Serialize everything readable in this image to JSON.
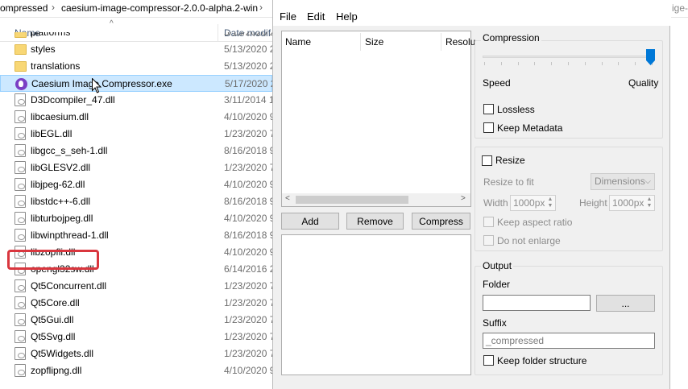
{
  "explorer": {
    "breadcrumb": [
      "ompressed",
      "caesium-image-compressor-2.0.0-alpha.2-win"
    ],
    "breadcrumb_tail": "ige-",
    "columns": {
      "name": "Name",
      "date": "Date modif"
    },
    "rows": [
      {
        "name": "platforms",
        "date": "5/13/2020 2",
        "type": "folder",
        "selected": false
      },
      {
        "name": "styles",
        "date": "5/13/2020 2",
        "type": "folder",
        "selected": false
      },
      {
        "name": "translations",
        "date": "5/13/2020 2",
        "type": "folder",
        "selected": false
      },
      {
        "name": "Caesium Image Compressor.exe",
        "date": "5/17/2020 2",
        "type": "exe",
        "selected": true
      },
      {
        "name": "D3Dcompiler_47.dll",
        "date": "3/11/2014 1",
        "type": "file",
        "selected": false
      },
      {
        "name": "libcaesium.dll",
        "date": "4/10/2020 9",
        "type": "file",
        "selected": false
      },
      {
        "name": "libEGL.dll",
        "date": "1/23/2020 7",
        "type": "file",
        "selected": false
      },
      {
        "name": "libgcc_s_seh-1.dll",
        "date": "8/16/2018 9",
        "type": "file",
        "selected": false
      },
      {
        "name": "libGLESV2.dll",
        "date": "1/23/2020 7",
        "type": "file",
        "selected": false
      },
      {
        "name": "libjpeg-62.dll",
        "date": "4/10/2020 9",
        "type": "file",
        "selected": false
      },
      {
        "name": "libstdc++-6.dll",
        "date": "8/16/2018 9",
        "type": "file",
        "selected": false
      },
      {
        "name": "libturbojpeg.dll",
        "date": "4/10/2020 9",
        "type": "file",
        "selected": false
      },
      {
        "name": "libwinpthread-1.dll",
        "date": "8/16/2018 9",
        "type": "file",
        "selected": false
      },
      {
        "name": "libzopfli.dll",
        "date": "4/10/2020 9",
        "type": "file",
        "selected": false
      },
      {
        "name": "opengl32sw.dll",
        "date": "6/14/2016 2",
        "type": "file",
        "selected": false
      },
      {
        "name": "Qt5Concurrent.dll",
        "date": "1/23/2020 7",
        "type": "file",
        "selected": false
      },
      {
        "name": "Qt5Core.dll",
        "date": "1/23/2020 7",
        "type": "file",
        "selected": false
      },
      {
        "name": "Qt5Gui.dll",
        "date": "1/23/2020 7",
        "type": "file",
        "selected": false
      },
      {
        "name": "Qt5Svg.dll",
        "date": "1/23/2020 7",
        "type": "file",
        "selected": false
      },
      {
        "name": "Qt5Widgets.dll",
        "date": "1/23/2020 7",
        "type": "file",
        "selected": false
      },
      {
        "name": "zopflipng.dll",
        "date": "4/10/2020 9",
        "type": "file",
        "selected": false
      }
    ],
    "highlight_color": "#d9363e",
    "selection_color": "#cce8ff"
  },
  "caesium": {
    "menu": [
      "File",
      "Edit",
      "Help"
    ],
    "table_columns": [
      "Name",
      "Size",
      "Resolu"
    ],
    "buttons": {
      "add": "Add",
      "remove": "Remove",
      "compress": "Compress"
    },
    "compression": {
      "title": "Compression",
      "left_label": "Speed",
      "right_label": "Quality",
      "level": 1.0,
      "lossless_label": "Lossless",
      "lossless_checked": false,
      "metadata_label": "Keep Metadata",
      "metadata_checked": false
    },
    "resize": {
      "title": "Resize",
      "checked": false,
      "fit_label": "Resize to fit",
      "fit_value": "Dimensions",
      "width_label": "Width",
      "width_value": "1000px",
      "height_label": "Height",
      "height_value": "1000px",
      "aspect_label": "Keep aspect ratio",
      "enlarge_label": "Do not enlarge"
    },
    "output": {
      "title": "Output",
      "folder_label": "Folder",
      "folder_value": "",
      "browse_label": "...",
      "suffix_label": "Suffix",
      "suffix_placeholder": "_compressed",
      "structure_label": "Keep folder structure",
      "structure_checked": false
    },
    "accent_color": "#0078d7"
  }
}
